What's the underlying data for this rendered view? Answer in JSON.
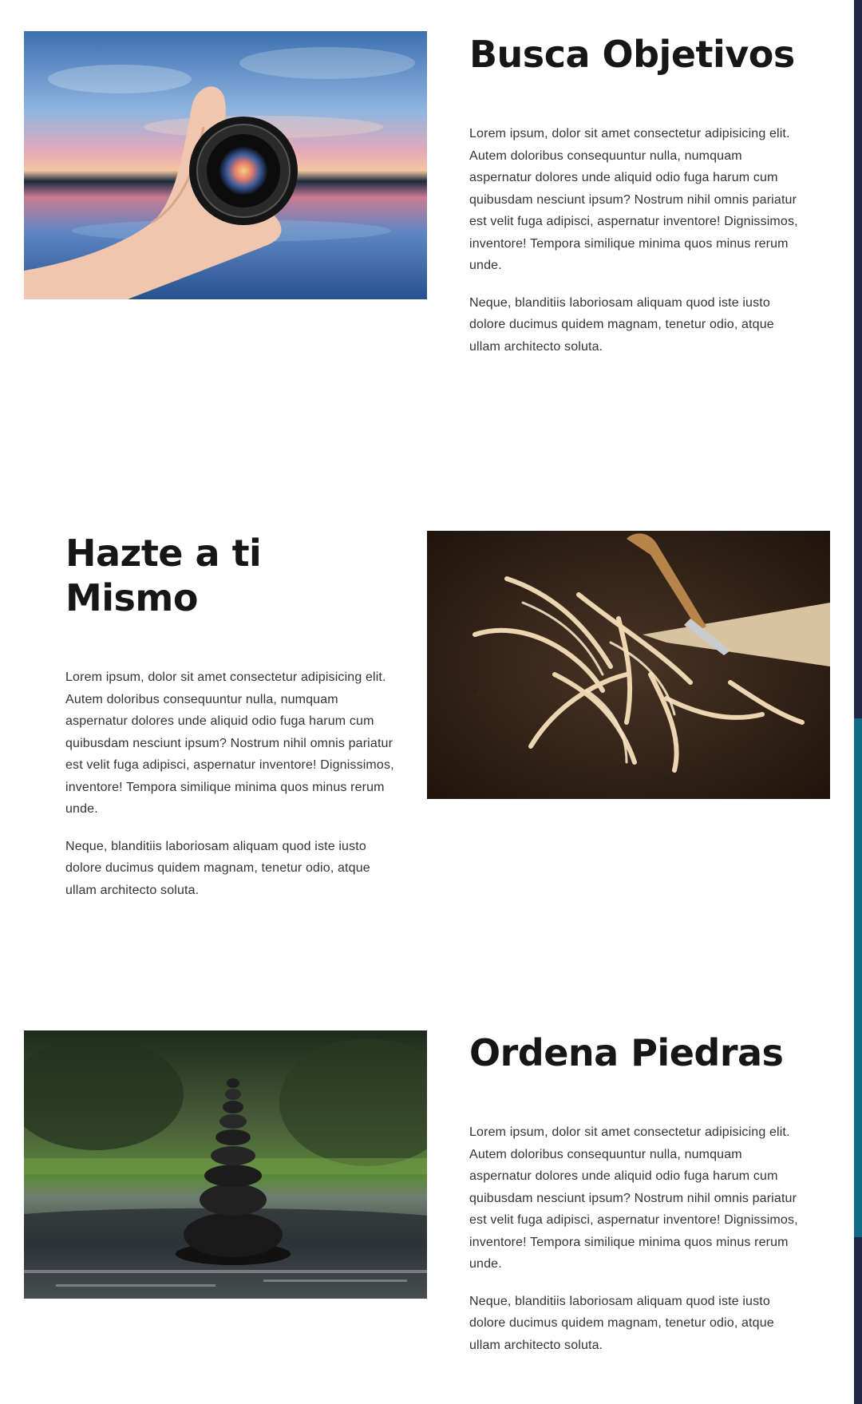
{
  "sections": [
    {
      "title": "Busca Objetivos",
      "image_alt": "hand holding camera lens over sunset lake",
      "paragraph_1": "Lorem ipsum, dolor sit amet consectetur adipisicing elit. Autem doloribus consequuntur nulla, numquam aspernatur dolores unde aliquid odio fuga harum cum quibusdam nesciunt ipsum? Nostrum nihil omnis pariatur est velit fuga adipisci, aspernatur inventore! Dignissimos, inventore! Tempora similique minima quos minus rerum unde.",
      "paragraph_2": "Neque, blanditiis laboriosam aliquam quod iste iusto dolore ducimus quidem magnam, tenetur odio, atque ullam architecto soluta."
    },
    {
      "title": "Hazte a ti Mismo",
      "image_alt": "wood shavings and carving knife on dark soil",
      "paragraph_1": "Lorem ipsum, dolor sit amet consectetur adipisicing elit. Autem doloribus consequuntur nulla, numquam aspernatur dolores unde aliquid odio fuga harum cum quibusdam nesciunt ipsum? Nostrum nihil omnis pariatur est velit fuga adipisci, aspernatur inventore! Dignissimos, inventore! Tempora similique minima quos minus rerum unde.",
      "paragraph_2": "Neque, blanditiis laboriosam aliquam quod iste iusto dolore ducimus quidem magnam, tenetur odio, atque ullam architecto soluta."
    },
    {
      "title": "Ordena Piedras",
      "image_alt": "stacked stones in a river",
      "paragraph_1": "Lorem ipsum, dolor sit amet consectetur adipisicing elit. Autem doloribus consequuntur nulla, numquam aspernatur dolores unde aliquid odio fuga harum cum quibusdam nesciunt ipsum? Nostrum nihil omnis pariatur est velit fuga adipisci, aspernatur inventore! Dignissimos, inventore! Tempora similique minima quos minus rerum unde.",
      "paragraph_2": "Neque, blanditiis laboriosam aliquam quod iste iusto dolore ducimus quidem magnam, tenetur odio, atque ullam architecto soluta."
    }
  ],
  "scrollbar": {
    "track_color": "#1f2744",
    "thumb_color": "#0f6a86",
    "scroll_fraction": 0.46
  }
}
